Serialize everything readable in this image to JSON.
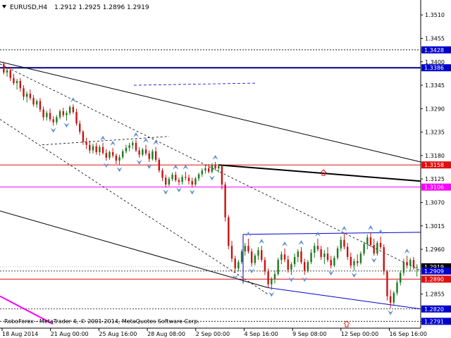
{
  "header": {
    "symbol": "EURUSD,H4",
    "quote": "1.2912 1.2925 1.2896 1.2919"
  },
  "copyright": "RoboForex - MetaTrader 4, © 2001-2014, MetaQuotes Software Corp.",
  "colors": {
    "bull": "#1e7a1e",
    "bear": "#cc1111",
    "blue": "#0000cc",
    "red": "#e01010",
    "magenta": "#ff00ff",
    "navy": "#00008b",
    "arrow": "#5f8fd6",
    "tag_bg": "#0000cc"
  },
  "chart_data": {
    "type": "candlestick",
    "title": "EURUSD,H4",
    "ylim": [
      1.2775,
      1.3545
    ],
    "yticks": [
      "1.3510",
      "1.3455",
      "1.3400",
      "1.3345",
      "1.3290",
      "1.3235",
      "1.3180",
      "1.3125",
      "1.3070",
      "1.3015",
      "1.2960",
      "1.2855"
    ],
    "xticks": [
      "18 Aug 2014",
      "21 Aug 00:00",
      "25 Aug 16:00",
      "28 Aug 08:00",
      "2 Sep 00:00",
      "4 Sep 16:00",
      "9 Sep 08:00",
      "12 Sep 00:00",
      "16 Sep 16:00"
    ],
    "levels": [
      {
        "value": 1.3428,
        "label": "1.3428",
        "style": "dotted"
      },
      {
        "value": 1.3386,
        "label": "1.3386",
        "style": "solid-blue"
      },
      {
        "value": 1.3158,
        "label": "1.3158",
        "style": "red"
      },
      {
        "value": 1.3106,
        "label": "1.3106",
        "style": "magenta"
      },
      {
        "value": 1.2919,
        "label": "1.2919",
        "style": "current"
      },
      {
        "value": 1.2909,
        "label": "1.2909",
        "style": "dotted"
      },
      {
        "value": 1.289,
        "label": "1.2890",
        "style": "red"
      },
      {
        "value": 1.282,
        "label": "1.2820",
        "style": "dotted"
      },
      {
        "value": 1.2791,
        "label": "1.2791",
        "style": "dotted"
      }
    ],
    "candles": [
      [
        1.3395,
        1.34,
        1.337,
        1.3375
      ],
      [
        1.3375,
        1.3385,
        1.3365,
        1.338
      ],
      [
        1.338,
        1.3388,
        1.3355,
        1.3362
      ],
      [
        1.3362,
        1.3372,
        1.3345,
        1.335
      ],
      [
        1.335,
        1.336,
        1.3335,
        1.3355
      ],
      [
        1.3355,
        1.3362,
        1.333,
        1.3338
      ],
      [
        1.3338,
        1.3345,
        1.331,
        1.3318
      ],
      [
        1.3318,
        1.333,
        1.3305,
        1.3325
      ],
      [
        1.3325,
        1.3335,
        1.331,
        1.3315
      ],
      [
        1.3315,
        1.3322,
        1.3295,
        1.33
      ],
      [
        1.33,
        1.3312,
        1.3292,
        1.3308
      ],
      [
        1.3308,
        1.3315,
        1.3282,
        1.3288
      ],
      [
        1.3288,
        1.3295,
        1.3262,
        1.327
      ],
      [
        1.327,
        1.3285,
        1.3262,
        1.328
      ],
      [
        1.328,
        1.329,
        1.326,
        1.3265
      ],
      [
        1.3265,
        1.3272,
        1.325,
        1.3258
      ],
      [
        1.3258,
        1.3275,
        1.3252,
        1.327
      ],
      [
        1.327,
        1.3288,
        1.3265,
        1.3284
      ],
      [
        1.3284,
        1.3292,
        1.327,
        1.3275
      ],
      [
        1.3275,
        1.3285,
        1.3262,
        1.328
      ],
      [
        1.328,
        1.3298,
        1.3275,
        1.3294
      ],
      [
        1.3294,
        1.33,
        1.3278,
        1.3282
      ],
      [
        1.3282,
        1.329,
        1.325,
        1.3255
      ],
      [
        1.3255,
        1.3262,
        1.323,
        1.3236
      ],
      [
        1.3236,
        1.324,
        1.3205,
        1.3212
      ],
      [
        1.3212,
        1.3222,
        1.3195,
        1.3205
      ],
      [
        1.3205,
        1.3215,
        1.3185,
        1.3192
      ],
      [
        1.3192,
        1.3208,
        1.3185,
        1.3202
      ],
      [
        1.3202,
        1.321,
        1.3182,
        1.3188
      ],
      [
        1.3188,
        1.3205,
        1.318,
        1.32
      ],
      [
        1.32,
        1.321,
        1.3182,
        1.3186
      ],
      [
        1.3186,
        1.3195,
        1.3168,
        1.3175
      ],
      [
        1.3175,
        1.3192,
        1.317,
        1.3188
      ],
      [
        1.3188,
        1.3198,
        1.3175,
        1.318
      ],
      [
        1.318,
        1.3185,
        1.316,
        1.3168
      ],
      [
        1.3168,
        1.3182,
        1.3158,
        1.3176
      ],
      [
        1.3176,
        1.3195,
        1.3172,
        1.319
      ],
      [
        1.319,
        1.3205,
        1.3185,
        1.3198
      ],
      [
        1.3198,
        1.321,
        1.319,
        1.3204
      ],
      [
        1.3204,
        1.3215,
        1.3195,
        1.321
      ],
      [
        1.321,
        1.3218,
        1.3188,
        1.3192
      ],
      [
        1.3192,
        1.32,
        1.3175,
        1.3182
      ],
      [
        1.3182,
        1.3198,
        1.3178,
        1.3194
      ],
      [
        1.3194,
        1.3205,
        1.318,
        1.3185
      ],
      [
        1.3185,
        1.3192,
        1.3165,
        1.3172
      ],
      [
        1.3172,
        1.3195,
        1.3168,
        1.319
      ],
      [
        1.319,
        1.32,
        1.3165,
        1.317
      ],
      [
        1.317,
        1.3175,
        1.314,
        1.3145
      ],
      [
        1.3145,
        1.315,
        1.312,
        1.3128
      ],
      [
        1.3128,
        1.3135,
        1.3105,
        1.3112
      ],
      [
        1.3112,
        1.313,
        1.3108,
        1.3125
      ],
      [
        1.3125,
        1.314,
        1.312,
        1.3135
      ],
      [
        1.3135,
        1.3142,
        1.3118,
        1.3122
      ],
      [
        1.3122,
        1.3128,
        1.311,
        1.3118
      ],
      [
        1.3118,
        1.3135,
        1.3112,
        1.313
      ],
      [
        1.313,
        1.3142,
        1.3122,
        1.3128
      ],
      [
        1.3128,
        1.3135,
        1.3112,
        1.312
      ],
      [
        1.312,
        1.3128,
        1.3105,
        1.3112
      ],
      [
        1.3112,
        1.313,
        1.3108,
        1.3126
      ],
      [
        1.3126,
        1.314,
        1.312,
        1.3136
      ],
      [
        1.3136,
        1.315,
        1.313,
        1.3145
      ],
      [
        1.3145,
        1.3158,
        1.3138,
        1.315
      ],
      [
        1.315,
        1.316,
        1.3138,
        1.3142
      ],
      [
        1.3142,
        1.3162,
        1.3138,
        1.3158
      ],
      [
        1.3158,
        1.3165,
        1.3145,
        1.315
      ],
      [
        1.315,
        1.316,
        1.314,
        1.3155
      ],
      [
        1.3155,
        1.3158,
        1.31,
        1.3112
      ],
      [
        1.3112,
        1.3118,
        1.3025,
        1.3035
      ],
      [
        1.3035,
        1.304,
        1.296,
        1.2968
      ],
      [
        1.2968,
        1.298,
        1.293,
        1.2938
      ],
      [
        1.2938,
        1.2945,
        1.2905,
        1.2915
      ],
      [
        1.2915,
        1.2935,
        1.2908,
        1.293
      ],
      [
        1.293,
        1.296,
        1.2925,
        1.2955
      ],
      [
        1.2955,
        1.2975,
        1.2945,
        1.2968
      ],
      [
        1.2968,
        1.2985,
        1.295,
        1.2955
      ],
      [
        1.2955,
        1.2962,
        1.292,
        1.2928
      ],
      [
        1.2928,
        1.295,
        1.2922,
        1.2945
      ],
      [
        1.2945,
        1.2965,
        1.2935,
        1.2958
      ],
      [
        1.2958,
        1.2968,
        1.293,
        1.2935
      ],
      [
        1.2935,
        1.2942,
        1.29,
        1.2908
      ],
      [
        1.2908,
        1.2915,
        1.287,
        1.2878
      ],
      [
        1.2878,
        1.2895,
        1.2865,
        1.289
      ],
      [
        1.289,
        1.291,
        1.288,
        1.2902
      ],
      [
        1.2902,
        1.294,
        1.2898,
        1.2935
      ],
      [
        1.2935,
        1.2955,
        1.2925,
        1.2948
      ],
      [
        1.2948,
        1.2962,
        1.293,
        1.2936
      ],
      [
        1.2936,
        1.2945,
        1.2905,
        1.2912
      ],
      [
        1.2912,
        1.293,
        1.29,
        1.2925
      ],
      [
        1.2925,
        1.295,
        1.2918,
        1.2942
      ],
      [
        1.2942,
        1.296,
        1.293,
        1.2955
      ],
      [
        1.2955,
        1.2965,
        1.2925,
        1.293
      ],
      [
        1.293,
        1.2938,
        1.29,
        1.291
      ],
      [
        1.291,
        1.2935,
        1.2905,
        1.293
      ],
      [
        1.293,
        1.296,
        1.2925,
        1.2952
      ],
      [
        1.2952,
        1.2975,
        1.294,
        1.2968
      ],
      [
        1.2968,
        1.2985,
        1.2955,
        1.296
      ],
      [
        1.296,
        1.2968,
        1.2935,
        1.2942
      ],
      [
        1.2942,
        1.2958,
        1.2925,
        1.295
      ],
      [
        1.295,
        1.2965,
        1.293,
        1.2935
      ],
      [
        1.2935,
        1.2945,
        1.2915,
        1.2922
      ],
      [
        1.2922,
        1.2945,
        1.2918,
        1.294
      ],
      [
        1.294,
        1.2968,
        1.2935,
        1.2962
      ],
      [
        1.2962,
        1.299,
        1.2955,
        1.2982
      ],
      [
        1.2982,
        1.2998,
        1.296,
        1.2966
      ],
      [
        1.2966,
        1.2975,
        1.2935,
        1.2942
      ],
      [
        1.2942,
        1.2952,
        1.2915,
        1.2922
      ],
      [
        1.2922,
        1.2938,
        1.291,
        1.2932
      ],
      [
        1.2932,
        1.2948,
        1.292,
        1.2928
      ],
      [
        1.2928,
        1.2955,
        1.2924,
        1.295
      ],
      [
        1.295,
        1.2978,
        1.2945,
        1.2972
      ],
      [
        1.2972,
        1.2995,
        1.296,
        1.2988
      ],
      [
        1.2988,
        1.3,
        1.2965,
        1.297
      ],
      [
        1.297,
        1.2985,
        1.2945,
        1.295
      ],
      [
        1.295,
        1.298,
        1.2945,
        1.2975
      ],
      [
        1.2975,
        1.299,
        1.296,
        1.2965
      ],
      [
        1.2965,
        1.2972,
        1.29,
        1.2908
      ],
      [
        1.2908,
        1.2912,
        1.284,
        1.285
      ],
      [
        1.285,
        1.2865,
        1.2822,
        1.2835
      ],
      [
        1.2835,
        1.2862,
        1.283,
        1.2858
      ],
      [
        1.2858,
        1.2888,
        1.2852,
        1.2882
      ],
      [
        1.2882,
        1.291,
        1.2875,
        1.2905
      ],
      [
        1.2905,
        1.2938,
        1.2898,
        1.293
      ],
      [
        1.293,
        1.2945,
        1.2915,
        1.2922
      ],
      [
        1.2922,
        1.294,
        1.2908,
        1.2935
      ],
      [
        1.2935,
        1.2942,
        1.2912,
        1.2918
      ],
      [
        1.2918,
        1.2925,
        1.2896,
        1.2919
      ]
    ]
  }
}
